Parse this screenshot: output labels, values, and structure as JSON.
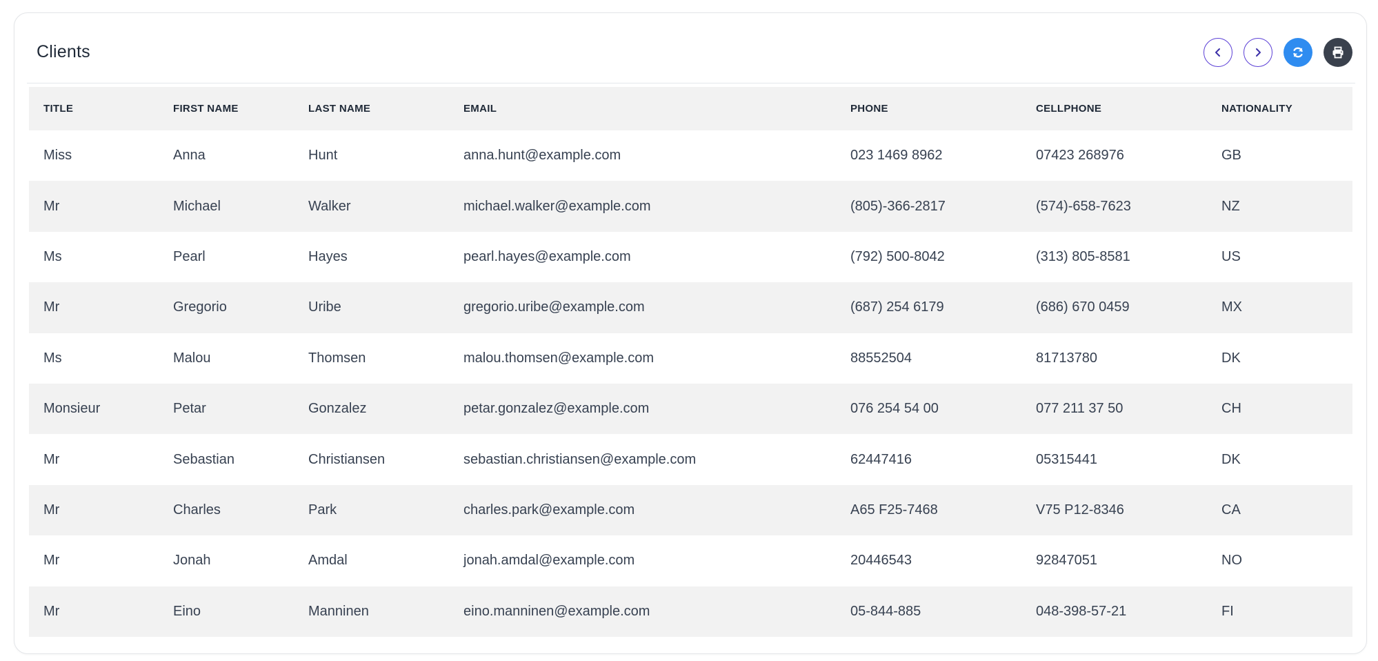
{
  "header": {
    "title": "Clients",
    "buttons": {
      "previous_icon": "chevron-left-icon",
      "next_icon": "chevron-right-icon",
      "refresh_icon": "refresh-icon",
      "print_icon": "print-icon"
    }
  },
  "colors": {
    "outline_button": "#5b3fd6",
    "refresh_button": "#2f8cf0",
    "print_button": "#3a414d",
    "row_stripe": "#f2f2f2"
  },
  "table": {
    "columns": [
      "TITLE",
      "FIRST NAME",
      "LAST NAME",
      "EMAIL",
      "PHONE",
      "CELLPHONE",
      "NATIONALITY"
    ],
    "rows": [
      [
        "Miss",
        "Anna",
        "Hunt",
        "anna.hunt@example.com",
        "023 1469 8962",
        "07423 268976",
        "GB"
      ],
      [
        "Mr",
        "Michael",
        "Walker",
        "michael.walker@example.com",
        "(805)-366-2817",
        "(574)-658-7623",
        "NZ"
      ],
      [
        "Ms",
        "Pearl",
        "Hayes",
        "pearl.hayes@example.com",
        "(792) 500-8042",
        "(313) 805-8581",
        "US"
      ],
      [
        "Mr",
        "Gregorio",
        "Uribe",
        "gregorio.uribe@example.com",
        "(687) 254 6179",
        "(686) 670 0459",
        "MX"
      ],
      [
        "Ms",
        "Malou",
        "Thomsen",
        "malou.thomsen@example.com",
        "88552504",
        "81713780",
        "DK"
      ],
      [
        "Monsieur",
        "Petar",
        "Gonzalez",
        "petar.gonzalez@example.com",
        "076 254 54 00",
        "077 211 37 50",
        "CH"
      ],
      [
        "Mr",
        "Sebastian",
        "Christiansen",
        "sebastian.christiansen@example.com",
        "62447416",
        "05315441",
        "DK"
      ],
      [
        "Mr",
        "Charles",
        "Park",
        "charles.park@example.com",
        "A65 F25-7468",
        "V75 P12-8346",
        "CA"
      ],
      [
        "Mr",
        "Jonah",
        "Amdal",
        "jonah.amdal@example.com",
        "20446543",
        "92847051",
        "NO"
      ],
      [
        "Mr",
        "Eino",
        "Manninen",
        "eino.manninen@example.com",
        "05-844-885",
        "048-398-57-21",
        "FI"
      ]
    ]
  }
}
